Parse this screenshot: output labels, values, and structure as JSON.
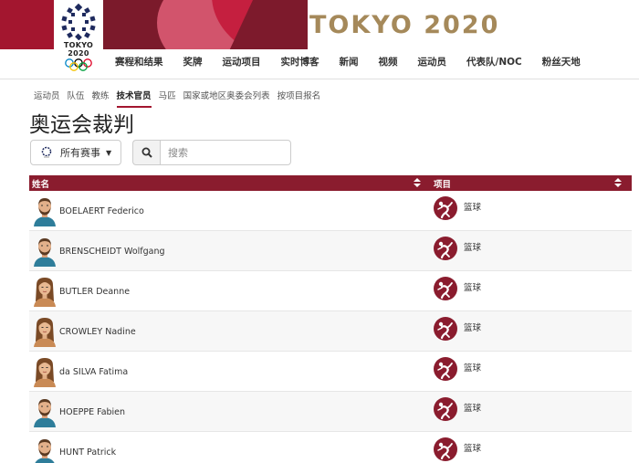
{
  "header": {
    "title": "TOKYO 2020",
    "logo_text": "TOKYO 2020",
    "brand_color": "#a3162f",
    "title_color": "#a5895a"
  },
  "main_nav": [
    "赛程和结果",
    "奖牌",
    "运动项目",
    "实时博客",
    "新闻",
    "视频",
    "运动员",
    "代表队/NOC",
    "粉丝天地"
  ],
  "sub_nav": {
    "items": [
      "运动员",
      "队伍",
      "教练",
      "技术官员",
      "马匹",
      "国家或地区奥委会列表",
      "按项目报名"
    ],
    "active": "技术官员"
  },
  "page_title": "奥运会裁判",
  "filters": {
    "event_select": "所有赛事",
    "search_placeholder": "搜索"
  },
  "table": {
    "columns": [
      "姓名",
      "项目"
    ],
    "rows": [
      {
        "name": "BOELAERT Federico",
        "sport": "篮球",
        "avatar": "male-beard"
      },
      {
        "name": "BRENSCHEIDT Wolfgang",
        "sport": "篮球",
        "avatar": "male-beard"
      },
      {
        "name": "BUTLER Deanne",
        "sport": "篮球",
        "avatar": "female"
      },
      {
        "name": "CROWLEY Nadine",
        "sport": "篮球",
        "avatar": "female"
      },
      {
        "name": "da SILVA Fatima",
        "sport": "篮球",
        "avatar": "female"
      },
      {
        "name": "HOEPPE Fabien",
        "sport": "篮球",
        "avatar": "male-beard"
      },
      {
        "name": "HUNT Patrick",
        "sport": "篮球",
        "avatar": "male-beard"
      }
    ]
  }
}
